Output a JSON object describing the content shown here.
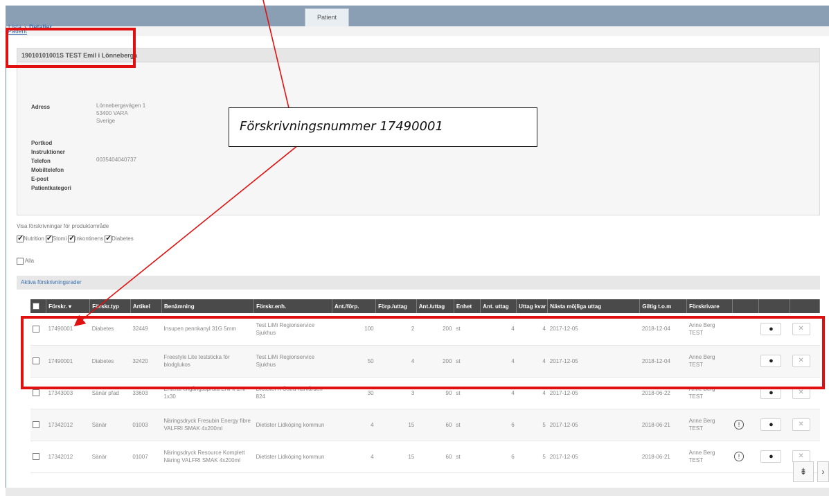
{
  "tabs": [
    {
      "label": "Patient"
    }
  ],
  "breadcrumb": {
    "patient": "Patient",
    "list": "Lista",
    "details": "Detaljer"
  },
  "patient_panel": {
    "header": "19010101001S  TEST Emil i Lönneberga",
    "fields": [
      {
        "label": "Adress",
        "value_lines": [
          "Lönnebergavägen 1",
          "53400 VARA",
          "Sverige"
        ]
      },
      {
        "label": "Portkod",
        "value_lines": []
      },
      {
        "label": "Instruktioner",
        "value_lines": []
      },
      {
        "label": "Telefon",
        "value_lines": [
          "0035404040737"
        ]
      },
      {
        "label": "Mobiltelefon",
        "value_lines": []
      },
      {
        "label": "E-post",
        "value_lines": []
      },
      {
        "label": "Patientkategori",
        "value_lines": []
      }
    ]
  },
  "filters": {
    "label": "Visa förskrivningar för produktområde",
    "options": [
      {
        "label": "Nutrition",
        "checked": true
      },
      {
        "label": "Stomi",
        "checked": true
      },
      {
        "label": "Inkontinens",
        "checked": true
      },
      {
        "label": "Diabetes",
        "checked": true
      }
    ],
    "all_label": "Alla"
  },
  "section_title": "Aktiva förskrivningsrader",
  "table": {
    "headers": [
      "Förskr. ▾",
      "Förskr.typ",
      "Artikel",
      "Benämning",
      "Förskr.enh.",
      "Ant./förp.",
      "Förp./uttag",
      "Ant./uttag",
      "Enhet",
      "Ant. uttag",
      "Uttag kvar",
      "Nästa möjliga uttag",
      "Giltig t.o.m",
      "Förskrivare"
    ],
    "rows": [
      {
        "nr": "17490001",
        "typ": "Diabetes",
        "artikel": "32449",
        "benamning": "Insupen pennkanyl 31G 5mm",
        "enhet_forskr": "Test LiMi Regionservice Sjukhus",
        "ant_forp": "100",
        "forp_uttag": "2",
        "ant_uttag": "200",
        "enhet": "st",
        "antal_uttag": "4",
        "uttag_kvar": "4",
        "nasta": "2017-12-05",
        "giltig": "2018-12-04",
        "forskrivare": "Anne Berg TEST",
        "info": false
      },
      {
        "nr": "17490001",
        "typ": "Diabetes",
        "artikel": "32420",
        "benamning": "Freestyle Lite teststicka för blodglukos",
        "enhet_forskr": "Test LiMi Regionservice Sjukhus",
        "ant_forp": "50",
        "forp_uttag": "4",
        "ant_uttag": "200",
        "enhet": "st",
        "antal_uttag": "4",
        "uttag_kvar": "4",
        "nasta": "2017-12-05",
        "giltig": "2018-12-04",
        "forskrivare": "Anne Berg TEST",
        "info": false
      },
      {
        "nr": "17343003",
        "typ": "Sänär pfad",
        "artikel": "33603",
        "benamning": "Enteral engångsspruta ENFit 1ml 1x30",
        "enhet_forskr": "Dietister A Östra närvården 824",
        "ant_forp": "30",
        "forp_uttag": "3",
        "ant_uttag": "90",
        "enhet": "st",
        "antal_uttag": "4",
        "uttag_kvar": "4",
        "nasta": "2017-12-05",
        "giltig": "2018-06-22",
        "forskrivare": "Anne Berg TEST",
        "info": false
      },
      {
        "nr": "17342012",
        "typ": "Sänär",
        "artikel": "01003",
        "benamning": "Näringsdryck Fresubin Energy fibre VALFRI SMAK 4x200ml",
        "enhet_forskr": "Dietister Lidköping kommun",
        "ant_forp": "4",
        "forp_uttag": "15",
        "ant_uttag": "60",
        "enhet": "st",
        "antal_uttag": "6",
        "uttag_kvar": "5",
        "nasta": "2017-12-05",
        "giltig": "2018-06-21",
        "forskrivare": "Anne Berg TEST",
        "info": true
      },
      {
        "nr": "17342012",
        "typ": "Sänär",
        "artikel": "01007",
        "benamning": "Näringsdryck Resource Komplett Näring VALFRI SMAK 4x200ml",
        "enhet_forskr": "Dietister Lidköping kommun",
        "ant_forp": "4",
        "forp_uttag": "15",
        "ant_uttag": "60",
        "enhet": "st",
        "antal_uttag": "6",
        "uttag_kvar": "5",
        "nasta": "2017-12-05",
        "giltig": "2018-06-21",
        "forskrivare": "Anne Berg TEST",
        "info": true
      }
    ]
  },
  "callout": {
    "text": "Förskrivningsnummer 17490001"
  },
  "colors": {
    "highlight": "#e01010",
    "topbar": "#8a9fb4",
    "header_bg": "#4a4a4a",
    "link": "#3a6fb0"
  },
  "icons": {
    "view": "eye-icon",
    "remove": "close-icon",
    "info": "info-icon",
    "scroll": "scroll-icon"
  }
}
